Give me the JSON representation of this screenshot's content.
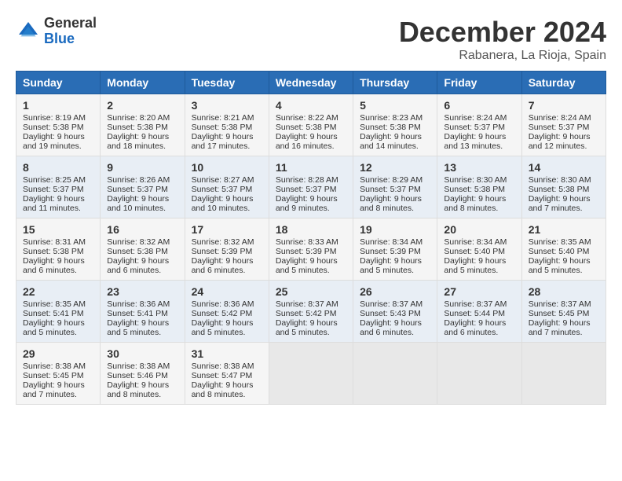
{
  "header": {
    "logo_general": "General",
    "logo_blue": "Blue",
    "month_title": "December 2024",
    "location": "Rabanera, La Rioja, Spain"
  },
  "days_of_week": [
    "Sunday",
    "Monday",
    "Tuesday",
    "Wednesday",
    "Thursday",
    "Friday",
    "Saturday"
  ],
  "weeks": [
    [
      {
        "day": 1,
        "sunrise": "8:19 AM",
        "sunset": "5:38 PM",
        "daylight": "9 hours and 19 minutes."
      },
      {
        "day": 2,
        "sunrise": "8:20 AM",
        "sunset": "5:38 PM",
        "daylight": "9 hours and 18 minutes."
      },
      {
        "day": 3,
        "sunrise": "8:21 AM",
        "sunset": "5:38 PM",
        "daylight": "9 hours and 17 minutes."
      },
      {
        "day": 4,
        "sunrise": "8:22 AM",
        "sunset": "5:38 PM",
        "daylight": "9 hours and 16 minutes."
      },
      {
        "day": 5,
        "sunrise": "8:23 AM",
        "sunset": "5:38 PM",
        "daylight": "9 hours and 14 minutes."
      },
      {
        "day": 6,
        "sunrise": "8:24 AM",
        "sunset": "5:37 PM",
        "daylight": "9 hours and 13 minutes."
      },
      {
        "day": 7,
        "sunrise": "8:24 AM",
        "sunset": "5:37 PM",
        "daylight": "9 hours and 12 minutes."
      }
    ],
    [
      {
        "day": 8,
        "sunrise": "8:25 AM",
        "sunset": "5:37 PM",
        "daylight": "9 hours and 11 minutes."
      },
      {
        "day": 9,
        "sunrise": "8:26 AM",
        "sunset": "5:37 PM",
        "daylight": "9 hours and 10 minutes."
      },
      {
        "day": 10,
        "sunrise": "8:27 AM",
        "sunset": "5:37 PM",
        "daylight": "9 hours and 10 minutes."
      },
      {
        "day": 11,
        "sunrise": "8:28 AM",
        "sunset": "5:37 PM",
        "daylight": "9 hours and 9 minutes."
      },
      {
        "day": 12,
        "sunrise": "8:29 AM",
        "sunset": "5:37 PM",
        "daylight": "9 hours and 8 minutes."
      },
      {
        "day": 13,
        "sunrise": "8:30 AM",
        "sunset": "5:38 PM",
        "daylight": "9 hours and 8 minutes."
      },
      {
        "day": 14,
        "sunrise": "8:30 AM",
        "sunset": "5:38 PM",
        "daylight": "9 hours and 7 minutes."
      }
    ],
    [
      {
        "day": 15,
        "sunrise": "8:31 AM",
        "sunset": "5:38 PM",
        "daylight": "9 hours and 6 minutes."
      },
      {
        "day": 16,
        "sunrise": "8:32 AM",
        "sunset": "5:38 PM",
        "daylight": "9 hours and 6 minutes."
      },
      {
        "day": 17,
        "sunrise": "8:32 AM",
        "sunset": "5:39 PM",
        "daylight": "9 hours and 6 minutes."
      },
      {
        "day": 18,
        "sunrise": "8:33 AM",
        "sunset": "5:39 PM",
        "daylight": "9 hours and 5 minutes."
      },
      {
        "day": 19,
        "sunrise": "8:34 AM",
        "sunset": "5:39 PM",
        "daylight": "9 hours and 5 minutes."
      },
      {
        "day": 20,
        "sunrise": "8:34 AM",
        "sunset": "5:40 PM",
        "daylight": "9 hours and 5 minutes."
      },
      {
        "day": 21,
        "sunrise": "8:35 AM",
        "sunset": "5:40 PM",
        "daylight": "9 hours and 5 minutes."
      }
    ],
    [
      {
        "day": 22,
        "sunrise": "8:35 AM",
        "sunset": "5:41 PM",
        "daylight": "9 hours and 5 minutes."
      },
      {
        "day": 23,
        "sunrise": "8:36 AM",
        "sunset": "5:41 PM",
        "daylight": "9 hours and 5 minutes."
      },
      {
        "day": 24,
        "sunrise": "8:36 AM",
        "sunset": "5:42 PM",
        "daylight": "9 hours and 5 minutes."
      },
      {
        "day": 25,
        "sunrise": "8:37 AM",
        "sunset": "5:42 PM",
        "daylight": "9 hours and 5 minutes."
      },
      {
        "day": 26,
        "sunrise": "8:37 AM",
        "sunset": "5:43 PM",
        "daylight": "9 hours and 6 minutes."
      },
      {
        "day": 27,
        "sunrise": "8:37 AM",
        "sunset": "5:44 PM",
        "daylight": "9 hours and 6 minutes."
      },
      {
        "day": 28,
        "sunrise": "8:37 AM",
        "sunset": "5:45 PM",
        "daylight": "9 hours and 7 minutes."
      }
    ],
    [
      {
        "day": 29,
        "sunrise": "8:38 AM",
        "sunset": "5:45 PM",
        "daylight": "9 hours and 7 minutes."
      },
      {
        "day": 30,
        "sunrise": "8:38 AM",
        "sunset": "5:46 PM",
        "daylight": "9 hours and 8 minutes."
      },
      {
        "day": 31,
        "sunrise": "8:38 AM",
        "sunset": "5:47 PM",
        "daylight": "9 hours and 8 minutes."
      },
      null,
      null,
      null,
      null
    ]
  ]
}
